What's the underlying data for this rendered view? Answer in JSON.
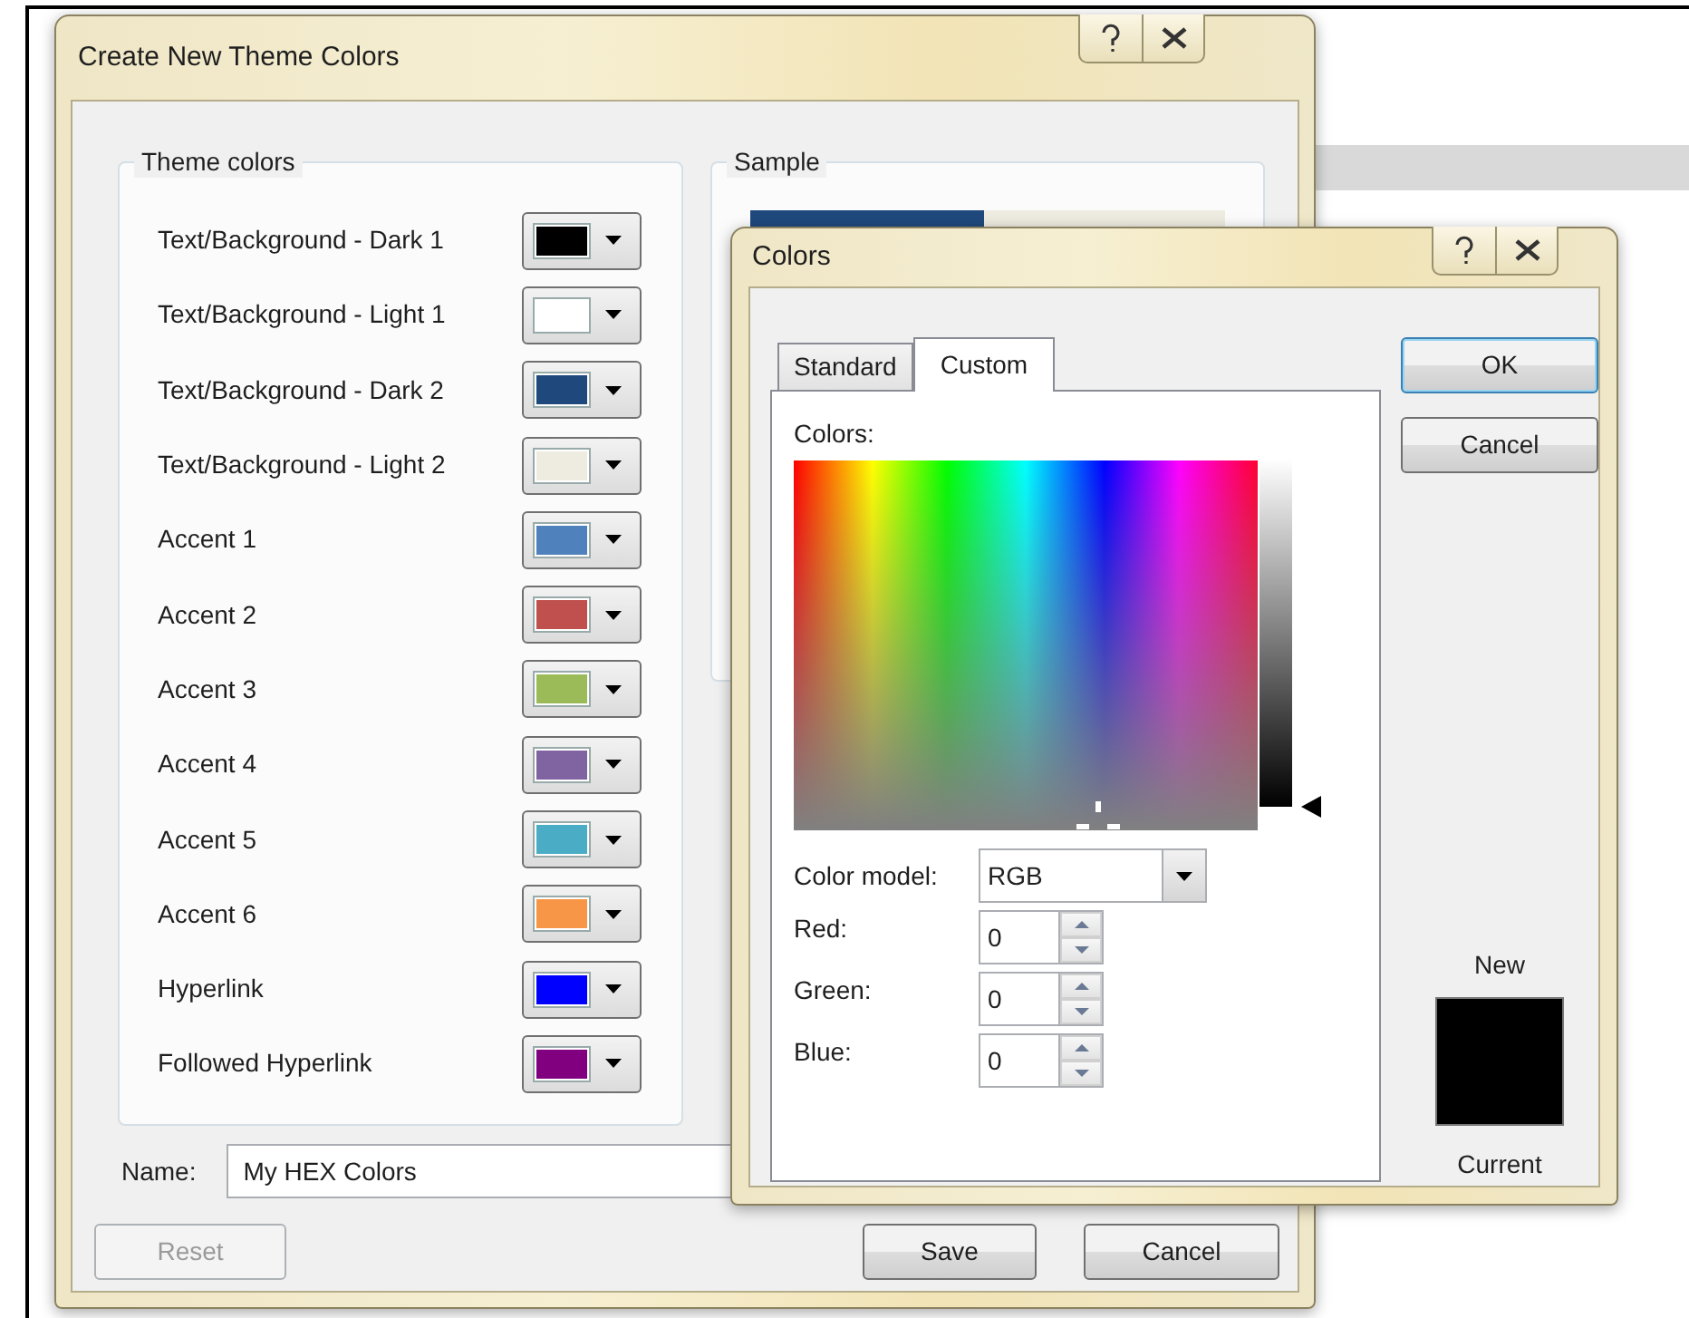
{
  "main_dialog": {
    "title": "Create New Theme Colors",
    "theme_colors": {
      "title": "Theme colors",
      "items": [
        {
          "label": "Text/Background - Dark 1",
          "color": "#000000"
        },
        {
          "label": "Text/Background - Light 1",
          "color": "#ffffff"
        },
        {
          "label": "Text/Background - Dark 2",
          "color": "#1f497d"
        },
        {
          "label": "Text/Background - Light 2",
          "color": "#eeece1"
        },
        {
          "label": "Accent 1",
          "color": "#4f81bd"
        },
        {
          "label": "Accent 2",
          "color": "#c0504d"
        },
        {
          "label": "Accent 3",
          "color": "#9bbb59"
        },
        {
          "label": "Accent 4",
          "color": "#8064a2"
        },
        {
          "label": "Accent 5",
          "color": "#4bacc6"
        },
        {
          "label": "Accent 6",
          "color": "#f79646"
        },
        {
          "label": "Hyperlink",
          "color": "#0000ff"
        },
        {
          "label": "Followed Hyperlink",
          "color": "#800080"
        }
      ]
    },
    "sample": {
      "title": "Sample"
    },
    "name_field": {
      "label": "Name:",
      "value": "My HEX Colors"
    },
    "buttons": [
      {
        "label": "Reset",
        "disabled": true
      },
      {
        "label": "Save",
        "disabled": false
      },
      {
        "label": "Cancel",
        "disabled": false
      }
    ]
  },
  "colors_dialog": {
    "title": "Colors",
    "tabs": [
      {
        "label": "Standard",
        "selected": false
      },
      {
        "label": "Custom",
        "selected": true
      }
    ],
    "colors_label": "Colors:",
    "luminance": {
      "level": 0
    },
    "color_model": {
      "label": "Color model:",
      "value": "RGB"
    },
    "channels": [
      {
        "label": "Red:",
        "value": "0"
      },
      {
        "label": "Green:",
        "value": "0"
      },
      {
        "label": "Blue:",
        "value": "0"
      }
    ],
    "buttons": [
      {
        "label": "OK",
        "default": true
      },
      {
        "label": "Cancel",
        "default": false
      }
    ],
    "preview": {
      "new_label": "New",
      "current_label": "Current",
      "color": "#000000"
    }
  }
}
